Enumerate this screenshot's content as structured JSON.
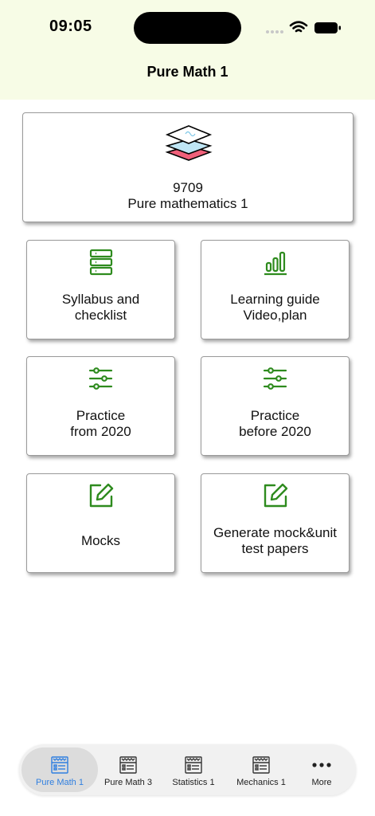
{
  "status_bar": {
    "time": "09:05"
  },
  "header": {
    "title": "Pure Math 1"
  },
  "hero_card": {
    "code": "9709",
    "name": "Pure mathematics 1",
    "icon": "layers-icon"
  },
  "tiles": [
    {
      "line1": "Syllabus and",
      "line2": "checklist",
      "icon": "server-list-icon"
    },
    {
      "line1": "Learning guide",
      "line2": "Video,plan",
      "icon": "bar-chart-icon"
    },
    {
      "line1": "Practice",
      "line2": "from 2020",
      "icon": "sliders-icon"
    },
    {
      "line1": "Practice",
      "line2": "before 2020",
      "icon": "sliders-icon"
    },
    {
      "line1": "Mocks",
      "icon": "edit-icon"
    },
    {
      "line1": "Generate mock&unit",
      "line2": "test papers",
      "icon": "edit-icon"
    }
  ],
  "tabbar": {
    "items": [
      {
        "label": "Pure Math 1",
        "icon": "notebook-icon",
        "active": true
      },
      {
        "label": "Pure Math 3",
        "icon": "notebook-icon"
      },
      {
        "label": "Statistics 1",
        "icon": "notebook-icon"
      },
      {
        "label": "Mechanics 1",
        "icon": "notebook-icon"
      },
      {
        "label": "More",
        "icon": "more-dots-icon"
      }
    ]
  },
  "colors": {
    "header_bg": "#f7fce6",
    "icon_green": "#2e8b1e",
    "active_tab": "#2f7fe0"
  }
}
